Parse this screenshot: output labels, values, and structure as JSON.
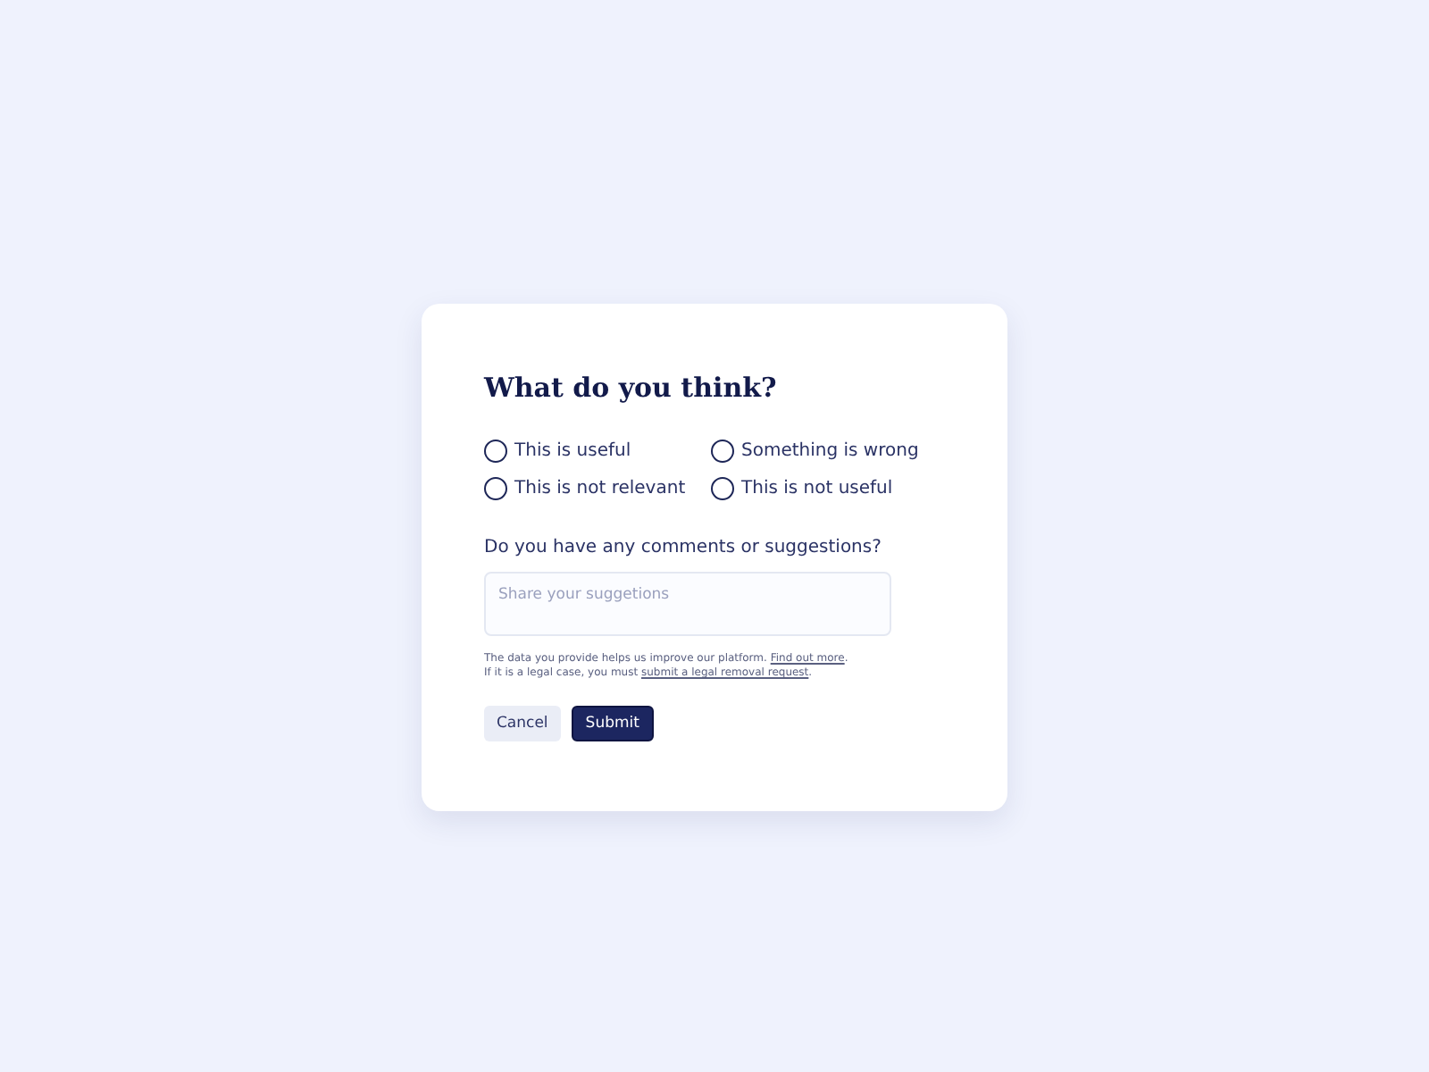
{
  "title": "What do you think?",
  "options": [
    {
      "label": "This is useful",
      "selected": false
    },
    {
      "label": "Something is wrong",
      "selected": false
    },
    {
      "label": "This is not relevant",
      "selected": false
    },
    {
      "label": "This is not useful",
      "selected": false
    }
  ],
  "comments": {
    "label": "Do you have any comments or suggestions?",
    "placeholder": "Share your suggetions"
  },
  "notes": [
    {
      "before": "The data you provide helps us improve our platform. ",
      "link": "Find out more",
      "after": "."
    },
    {
      "before": "If it is a legal case, you must ",
      "link": "submit a legal removal request",
      "after": "."
    }
  ],
  "buttons": [
    {
      "label": "Cancel",
      "kind": "secondary"
    },
    {
      "label": "Submit",
      "kind": "primary"
    }
  ]
}
